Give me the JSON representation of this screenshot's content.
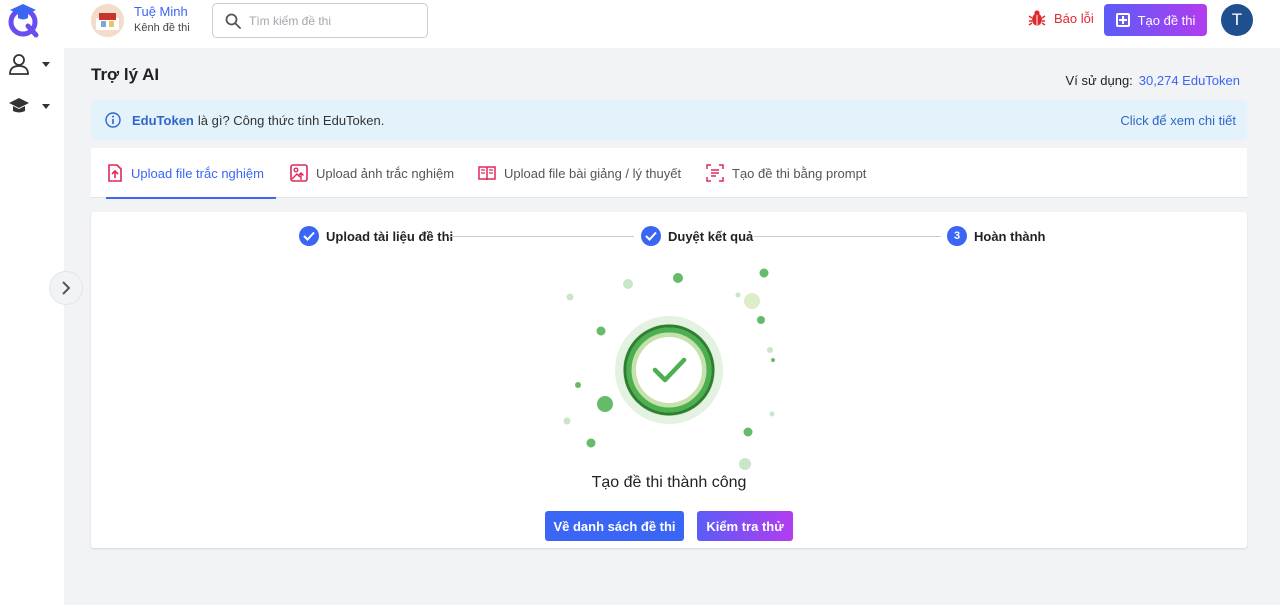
{
  "header": {
    "user_name": "Tuệ Minh",
    "user_subtitle": "Kênh đề thi",
    "search_placeholder": "Tìm kiếm đề thi",
    "report_label": "Báo lỗi",
    "create_label": "Tạo đề thi",
    "avatar_initial": "T"
  },
  "sidebar": {
    "items": [
      {
        "icon": "user-icon"
      },
      {
        "icon": "graduation-cap-icon"
      }
    ]
  },
  "page": {
    "title": "Trợ lý AI",
    "wallet_label": "Ví sử dụng:",
    "wallet_value": "30,274 EduToken"
  },
  "info": {
    "bold": "EduToken",
    "text": "là gì? Công thức tính EduToken.",
    "link": "Click để xem chi tiết"
  },
  "tabs": [
    {
      "label": "Upload file trắc nghiệm",
      "active": true
    },
    {
      "label": "Upload ảnh trắc nghiệm",
      "active": false
    },
    {
      "label": "Upload file bài giảng / lý thuyết",
      "active": false
    },
    {
      "label": "Tạo đề thi bằng prompt",
      "active": false
    }
  ],
  "steps": [
    {
      "label": "Upload tài liệu đề thi",
      "state": "done"
    },
    {
      "label": "Duyệt kết quả",
      "state": "done"
    },
    {
      "label": "Hoàn thành",
      "state": "current",
      "number": "3"
    }
  ],
  "result": {
    "message": "Tạo đề thi thành công",
    "back_button": "Về danh sách đề thi",
    "try_button": "Kiểm tra thử"
  },
  "colors": {
    "accent": "#3b66f5",
    "gradient_start": "#5b5cf6",
    "gradient_end": "#b23cf0",
    "success": "#4caf50",
    "error": "#e0282e"
  }
}
